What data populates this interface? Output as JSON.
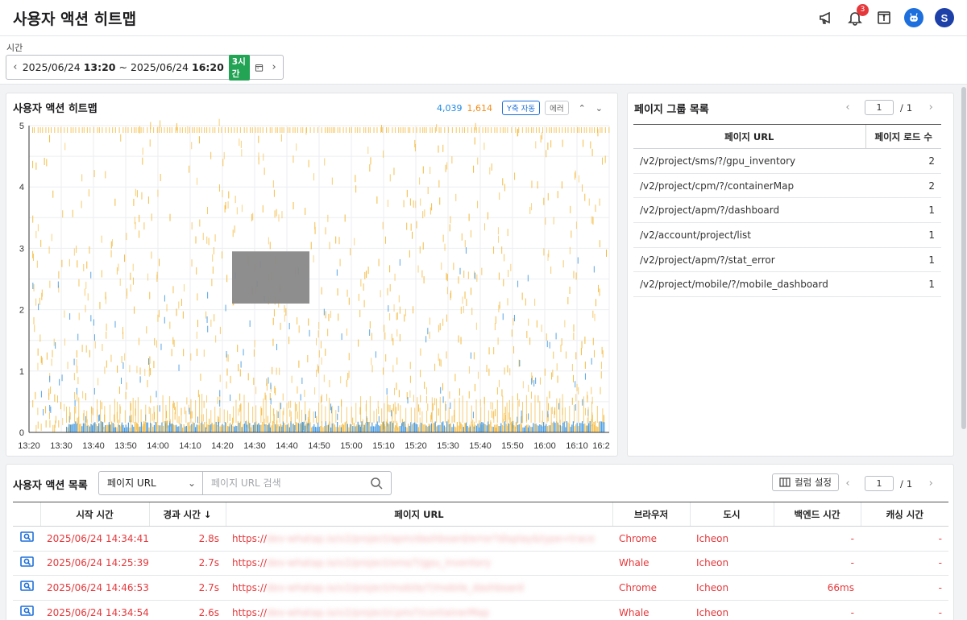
{
  "header": {
    "title": "사용자 액션 히트맵",
    "notification_count": "3",
    "user_initial": "S"
  },
  "time": {
    "label": "시간",
    "start_date": "2025/06/24",
    "start_time": "13:20",
    "separator": "~",
    "end_date": "2025/06/24",
    "end_time": "16:20",
    "range_badge": "3시간"
  },
  "heatmap": {
    "title": "사용자 액션 히트맵",
    "count_normal": "4,039",
    "count_error": "1,614",
    "y_auto_label": "Y축 자동",
    "error_label": "에러",
    "chart_data": {
      "type": "heatmap",
      "x_ticks": [
        "13:20",
        "13:30",
        "13:40",
        "13:50",
        "14:00",
        "14:10",
        "14:20",
        "14:30",
        "14:40",
        "14:50",
        "15:00",
        "15:10",
        "15:20",
        "15:30",
        "15:40",
        "15:50",
        "16:00",
        "16:10",
        "16:2"
      ],
      "y_ticks": [
        "0",
        "1",
        "2",
        "3",
        "4",
        "5"
      ],
      "ylim": [
        0,
        5
      ],
      "selection": {
        "x_from": "14:23",
        "x_to": "14:47",
        "y_from": 2.1,
        "y_to": 2.95
      },
      "colors": {
        "normal": "#2f8fe0",
        "error": "#f4b83a",
        "selection": "#888888"
      },
      "grid": true
    }
  },
  "page_group": {
    "title": "페이지 그룹 목록",
    "page_current": "1",
    "page_total": "1",
    "headers": [
      "페이지 URL",
      "페이지 로드 수"
    ],
    "rows": [
      {
        "url": "/v2/project/sms/?/gpu_inventory",
        "count": "2"
      },
      {
        "url": "/v2/project/cpm/?/containerMap",
        "count": "2"
      },
      {
        "url": "/v2/project/apm/?/dashboard",
        "count": "1"
      },
      {
        "url": "/v2/account/project/list",
        "count": "1"
      },
      {
        "url": "/v2/project/apm/?/stat_error",
        "count": "1"
      },
      {
        "url": "/v2/project/mobile/?/mobile_dashboard",
        "count": "1"
      }
    ]
  },
  "action_list": {
    "title": "사용자 액션 목록",
    "filter_value": "페이지 URL",
    "search_placeholder": "페이지 URL 검색",
    "column_settings": "컬럼 설정",
    "page_current": "1",
    "page_total": "1",
    "headers": [
      "시작 시간",
      "경과 시간",
      "페이지 URL",
      "브라우저",
      "도시",
      "백엔드 시간",
      "캐싱 시간"
    ],
    "rows": [
      {
        "start": "2025/06/24 14:34:41",
        "elapsed": "2.8s",
        "url_prefix": "https://",
        "browser": "Chrome",
        "city": "Icheon",
        "backend": "-",
        "cache": "-"
      },
      {
        "start": "2025/06/24 14:25:39",
        "elapsed": "2.7s",
        "url_prefix": "https://",
        "browser": "Whale",
        "city": "Icheon",
        "backend": "-",
        "cache": "-"
      },
      {
        "start": "2025/06/24 14:46:53",
        "elapsed": "2.7s",
        "url_prefix": "https://",
        "browser": "Chrome",
        "city": "Icheon",
        "backend": "66ms",
        "cache": "-"
      },
      {
        "start": "2025/06/24 14:34:54",
        "elapsed": "2.6s",
        "url_prefix": "https://",
        "browser": "Whale",
        "city": "Icheon",
        "backend": "-",
        "cache": "-"
      }
    ]
  }
}
